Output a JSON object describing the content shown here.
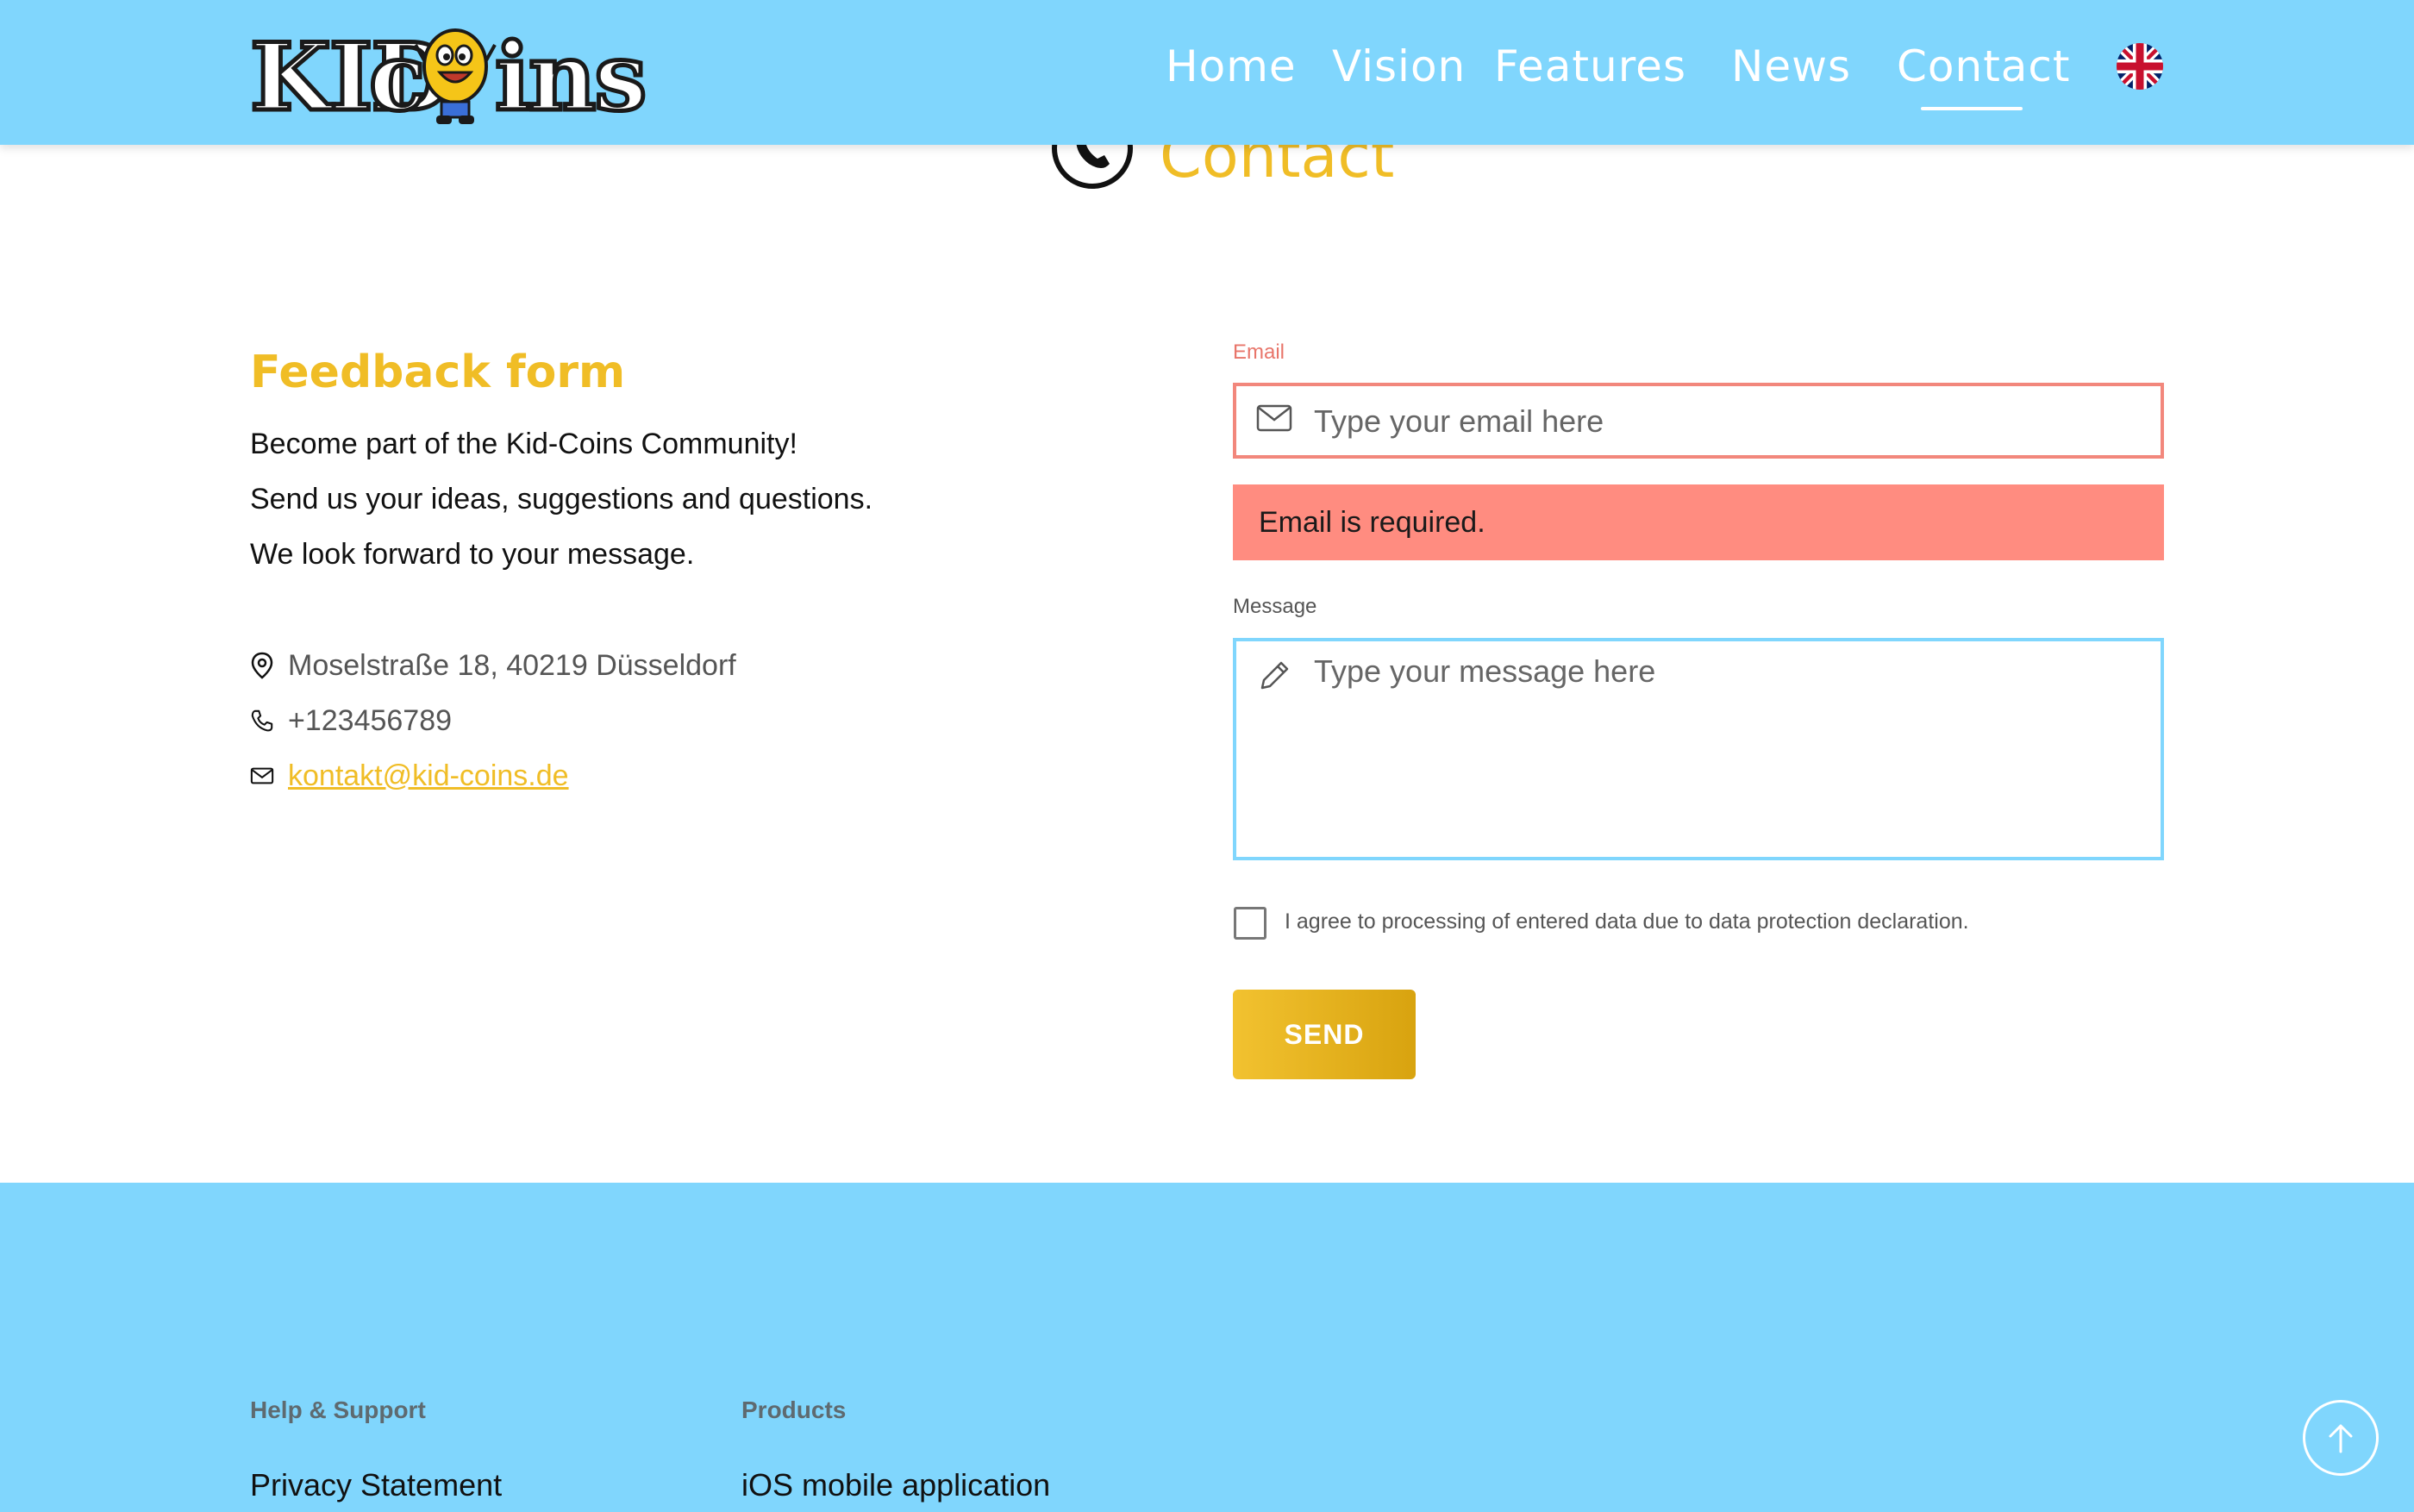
{
  "brand": {
    "logo_alt": "KIDcoins"
  },
  "nav": {
    "items": [
      "Home",
      "Vision",
      "Features",
      "News",
      "Contact"
    ],
    "active": "Contact",
    "language": "English (UK flag)"
  },
  "section": {
    "title": "Contact"
  },
  "feedback": {
    "title": "Feedback form",
    "intro": [
      "Become part of the Kid-Coins Community!",
      "Send us your ideas, suggestions and questions.",
      "We look forward to your message."
    ],
    "address": "Moselstraße 18, 40219 Düsseldorf",
    "phone": "+123456789",
    "email": "kontakt@kid-coins.de"
  },
  "form": {
    "email_label": "Email",
    "email_placeholder": "Type your email here",
    "email_value": "",
    "email_error": "Email is required.",
    "message_label": "Message",
    "message_placeholder": "Type your message here",
    "message_value": "",
    "consent_text": "I agree to processing of entered data due to data protection declaration.",
    "consent_checked": false,
    "send_label": "SEND"
  },
  "footer": {
    "columns": [
      {
        "heading": "Help & Support",
        "links": [
          "Privacy Statement"
        ]
      },
      {
        "heading": "Products",
        "links": [
          "iOS mobile application"
        ]
      }
    ]
  },
  "colors": {
    "header_bg": "#80d6fd",
    "accent_yellow": "#f0bd26",
    "error_bg": "#ff8c80",
    "error_border": "#f2877c",
    "focus_border": "#80d6fd"
  },
  "icons": {
    "address": "map-pin-icon",
    "phone": "phone-icon",
    "email": "envelope-icon",
    "message": "pencil-icon",
    "scroll_top": "arrow-up-icon"
  }
}
